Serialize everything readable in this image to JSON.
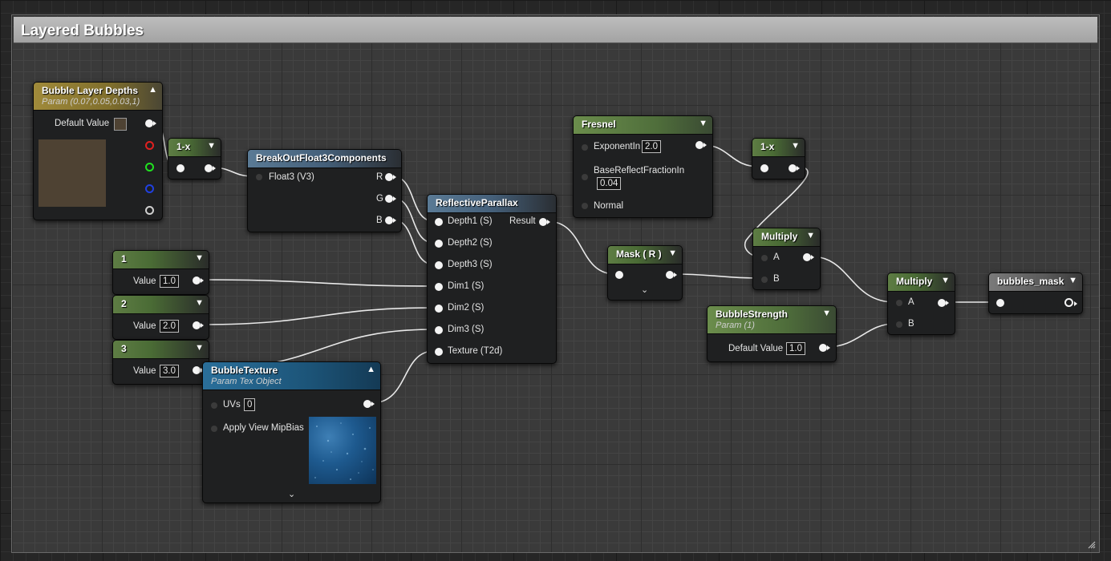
{
  "comment": {
    "title": "Layered Bubbles"
  },
  "nodes": {
    "bubble_layer_depths": {
      "title": "Bubble Layer Depths",
      "subtitle": "Param (0.07,0.05,0.03,1)",
      "default_label": "Default Value",
      "swatch_color": "#4e4233"
    },
    "one_minus_1": {
      "title": "1-x"
    },
    "breakout": {
      "title": "BreakOutFloat3Components",
      "input": "Float3 (V3)",
      "outputs": [
        "R",
        "G",
        "B"
      ]
    },
    "reflective_parallax": {
      "title": "ReflectiveParallax",
      "inputs": [
        "Depth1 (S)",
        "Depth2 (S)",
        "Depth3 (S)",
        "Dim1 (S)",
        "Dim2 (S)",
        "Dim3 (S)",
        "Texture (T2d)"
      ],
      "output": "Result"
    },
    "const1": {
      "title": "1",
      "value_label": "Value",
      "value": "1.0"
    },
    "const2": {
      "title": "2",
      "value_label": "Value",
      "value": "2.0"
    },
    "const3": {
      "title": "3",
      "value_label": "Value",
      "value": "3.0"
    },
    "bubble_texture": {
      "title": "BubbleTexture",
      "subtitle": "Param Tex Object",
      "uvs_label": "UVs",
      "uvs_value": "0",
      "mip_label": "Apply View MipBias"
    },
    "fresnel": {
      "title": "Fresnel",
      "exponent_label": "ExponentIn",
      "exponent_value": "2.0",
      "base_label": "BaseReflectFractionIn",
      "base_value": "0.04",
      "normal_label": "Normal"
    },
    "one_minus_2": {
      "title": "1-x"
    },
    "mask": {
      "title": "Mask ( R )"
    },
    "multiply1": {
      "title": "Multiply",
      "a": "A",
      "b": "B"
    },
    "bubble_strength": {
      "title": "BubbleStrength",
      "subtitle": "Param (1)",
      "default_label": "Default Value",
      "value": "1.0"
    },
    "multiply2": {
      "title": "Multiply",
      "a": "A",
      "b": "B"
    },
    "bubbles_mask": {
      "title": "bubbles_mask"
    }
  },
  "icons": {
    "chevron_down": "chevron-down-icon",
    "chevron_up": "chevron-up-icon"
  }
}
